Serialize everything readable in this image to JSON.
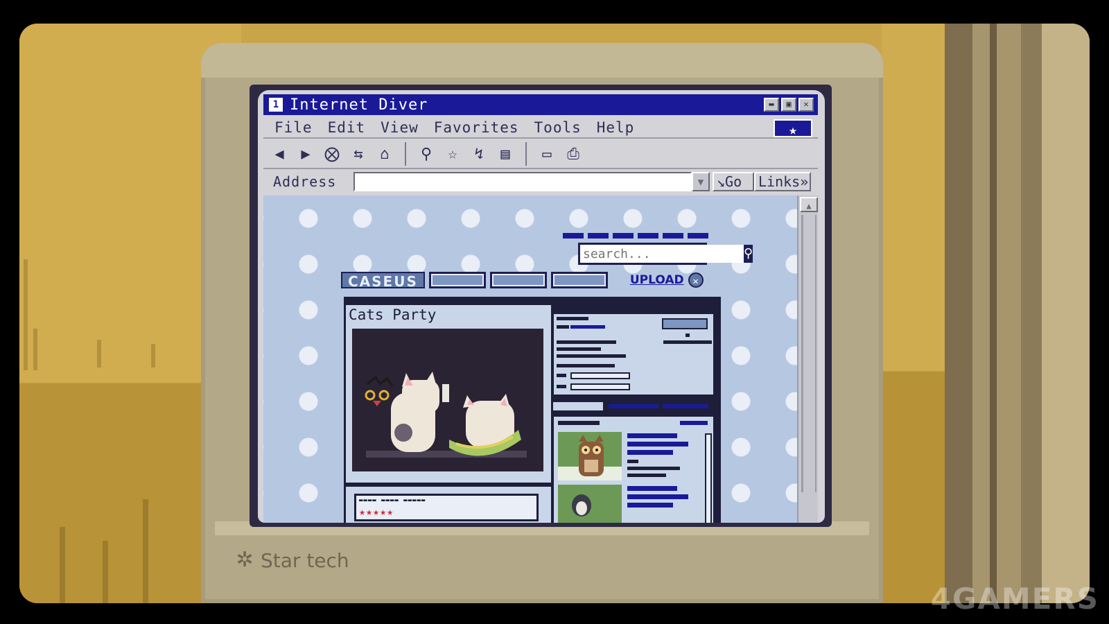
{
  "browser": {
    "title": "Internet Diver",
    "title_icon": "1",
    "window_buttons": [
      "minimize",
      "maximize",
      "close"
    ],
    "menu": [
      "File",
      "Edit",
      "View",
      "Favorites",
      "Tools",
      "Help"
    ],
    "menu_star_icon": "star-icon",
    "toolbar_icons": [
      "back-arrow-icon",
      "forward-arrow-icon",
      "stop-icon",
      "refresh-icon",
      "home-icon",
      "search-icon",
      "favorites-star-icon",
      "history-icon",
      "channels-icon",
      "mail-icon",
      "print-icon"
    ],
    "address_label": "Address",
    "address_value": "",
    "go_label": "↘Go",
    "links_label": "Links»"
  },
  "site": {
    "search_placeholder": "search...",
    "logo_text": "CASEUS",
    "upload_label": "UPLOAD",
    "post_title": "Cats Party",
    "rating_stars": "★★★★★",
    "colors": {
      "page_bg": "#b6c7e1",
      "dark": "#1e1e3a",
      "link": "#1a1a99",
      "stars": "#d0303a"
    }
  },
  "monitor": {
    "brand": "Star tech"
  },
  "watermark": "4GAMERS"
}
